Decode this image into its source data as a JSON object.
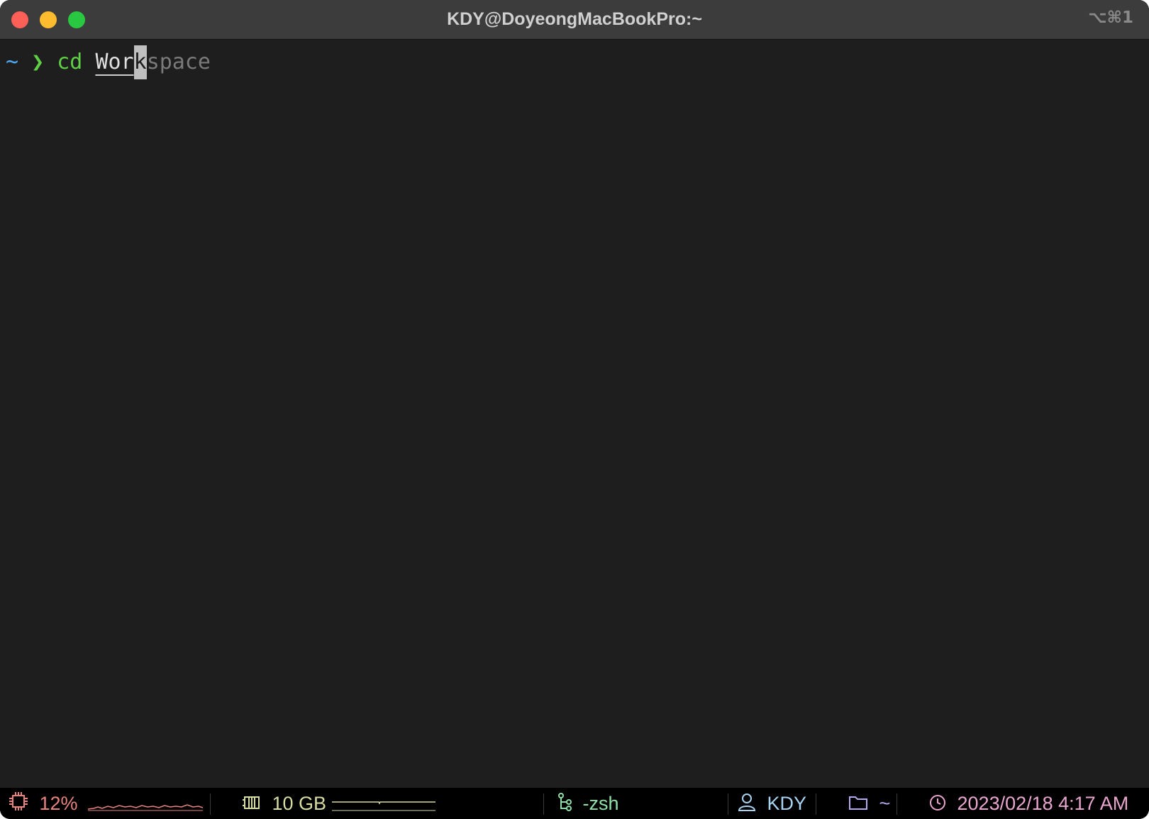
{
  "window": {
    "title": "KDY@DoyeongMacBookPro:~",
    "shortcut": "⌥⌘1"
  },
  "terminal": {
    "prompt_dir": "~",
    "prompt_arrow": "❯",
    "command": "cd",
    "typed_text": "Wor",
    "cursor_char": "k",
    "suggestion": "space"
  },
  "statusbar": {
    "cpu": {
      "icon": "cpu-chip-icon",
      "value": "12%",
      "color": "#e8847f"
    },
    "memory": {
      "icon": "memory-icon",
      "value": "10 GB",
      "color": "#d8dca0"
    },
    "job": {
      "icon": "git-branch-icon",
      "value": "-zsh",
      "color": "#8fe0a8"
    },
    "user": {
      "icon": "user-icon",
      "value": "KDY",
      "color": "#a8d4f2"
    },
    "path": {
      "icon": "folder-icon",
      "value": "~",
      "color": "#b6a7ee"
    },
    "clock": {
      "icon": "clock-icon",
      "value": "2023/02/18 4:17 AM",
      "color": "#e8a6cf"
    }
  }
}
